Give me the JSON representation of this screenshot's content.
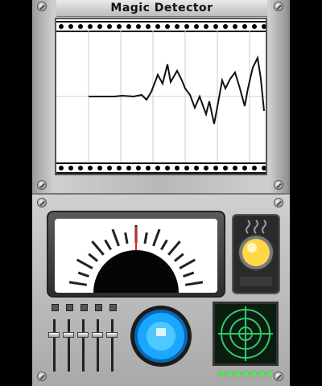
{
  "app": {
    "title": "Magic Detector"
  },
  "colors": {
    "needle": "#dd2222",
    "lamp": "#ffd84a",
    "button": "#1aa8ff",
    "radar": "#34c86b",
    "led": "#5ce05c"
  },
  "icons": {
    "screws": "screw-icon",
    "lamp": "lamp-icon",
    "button": "scan-button",
    "radar": "radar-icon"
  }
}
